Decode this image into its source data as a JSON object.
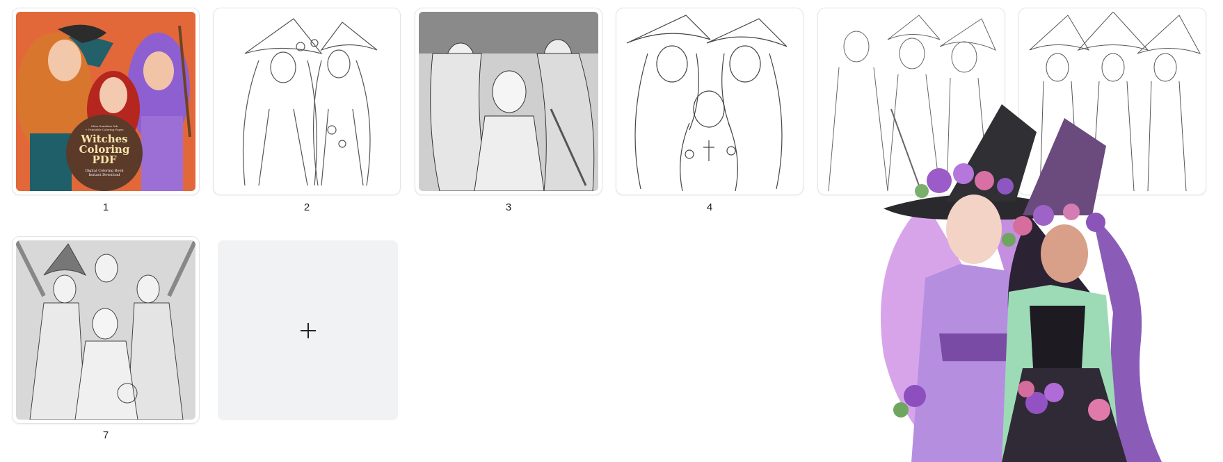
{
  "pages": [
    {
      "number": "1",
      "kind": "cover"
    },
    {
      "number": "2",
      "kind": "lineart"
    },
    {
      "number": "3",
      "kind": "grayscale"
    },
    {
      "number": "4",
      "kind": "lineart"
    },
    {
      "number": "",
      "kind": "lineart"
    },
    {
      "number": "",
      "kind": "lineart"
    },
    {
      "number": "7",
      "kind": "grayscale"
    }
  ],
  "cover": {
    "pretitle_1": "Mina Sunshine Ink",
    "pretitle_2": "+ Printable Coloring Pages",
    "title_line1": "Witches",
    "title_line2": "Coloring",
    "title_line3": "PDF",
    "subtitle_1": "Digital Coloring Book",
    "subtitle_2": "Instant Download"
  },
  "add_page": {
    "icon": "plus-icon"
  },
  "overlay": {
    "icon": "witches-illustration"
  },
  "colors": {
    "cover_bg": "#e2683a",
    "add_tile_bg": "#f1f2f4",
    "overlay_purple": "#b58ee0",
    "overlay_dress_green": "#9ddbb6"
  }
}
